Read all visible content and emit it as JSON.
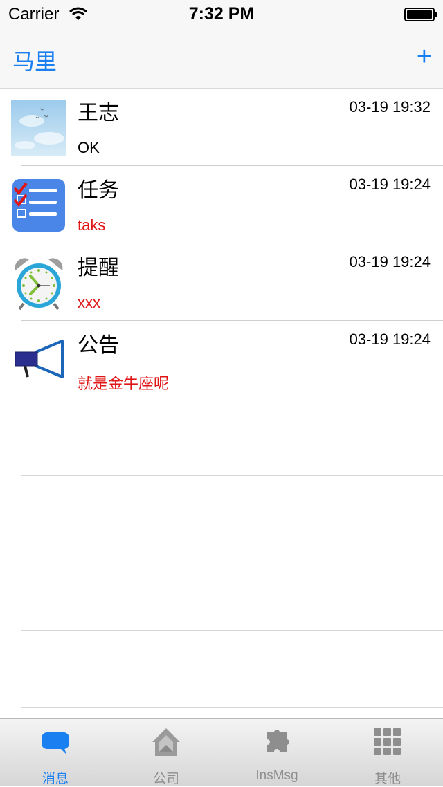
{
  "status_bar": {
    "carrier": "Carrier",
    "time": "7:32 PM"
  },
  "nav": {
    "title": "马里",
    "add_label": "+"
  },
  "messages": [
    {
      "name": "王志",
      "time": "03-19 19:32",
      "preview": "OK",
      "icon": "sky-photo-avatar",
      "preview_color": "#000000"
    },
    {
      "name": "任务",
      "time": "03-19 19:24",
      "preview": "taks",
      "icon": "task-checklist-icon",
      "preview_color": "#e01515"
    },
    {
      "name": "提醒",
      "time": "03-19 19:24",
      "preview": "xxx",
      "icon": "alarm-clock-icon",
      "preview_color": "#e01515"
    },
    {
      "name": "公告",
      "time": "03-19 19:24",
      "preview": "就是金牛座呢",
      "icon": "megaphone-icon",
      "preview_color": "#e01515"
    }
  ],
  "tabs": [
    {
      "label": "消息",
      "icon": "chat-bubble-icon",
      "active": true
    },
    {
      "label": "公司",
      "icon": "house-icon",
      "active": false
    },
    {
      "label": "InsMsg",
      "icon": "puzzle-icon",
      "active": false
    },
    {
      "label": "其他",
      "icon": "grid-icon",
      "active": false
    }
  ],
  "colors": {
    "accent": "#1a7ff0",
    "alert_text": "#e01515"
  }
}
